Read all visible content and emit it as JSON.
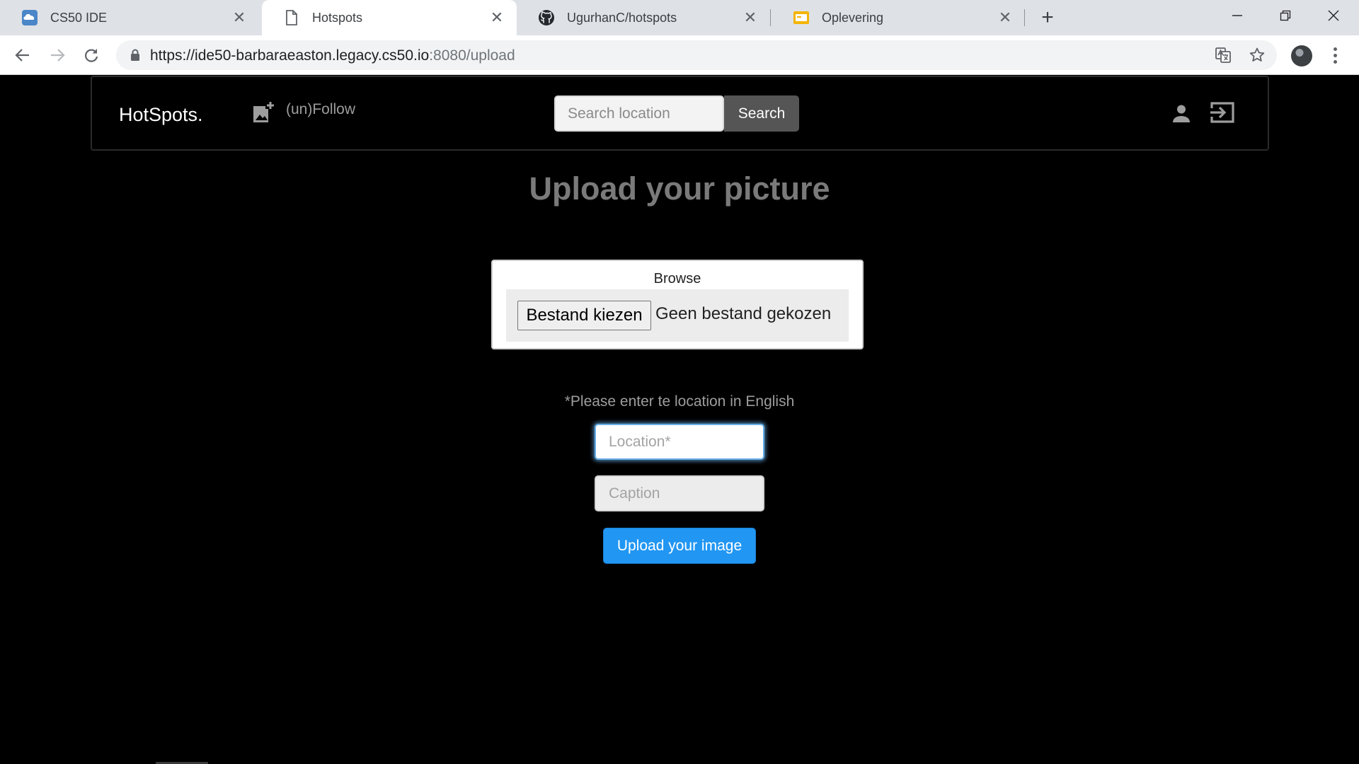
{
  "browser": {
    "tabs": [
      {
        "title": "CS50 IDE",
        "icon": "cloud9-icon"
      },
      {
        "title": "Hotspots",
        "icon": "page-icon",
        "active": true
      },
      {
        "title": "UgurhanC/hotspots",
        "icon": "github-icon"
      },
      {
        "title": "Oplevering",
        "icon": "slides-icon"
      }
    ],
    "url_main": "https://ide50-barbaraeaston.legacy.cs50.io",
    "url_rest": ":8080/upload"
  },
  "navbar": {
    "brand": "HotSpots.",
    "follow_label": "(un)Follow",
    "search_placeholder": "Search location",
    "search_button": "Search"
  },
  "main": {
    "heading": "Upload your picture",
    "browse_label": "Browse",
    "file_button": "Bestand kiezen",
    "file_status": "Geen bestand gekozen",
    "note": "*Please enter te location in English",
    "location_placeholder": "Location*",
    "caption_placeholder": "Caption",
    "upload_button": "Upload your image"
  },
  "colors": {
    "accent": "#2196f3",
    "page_background": "#000000",
    "focus_ring": "#66afe9"
  }
}
